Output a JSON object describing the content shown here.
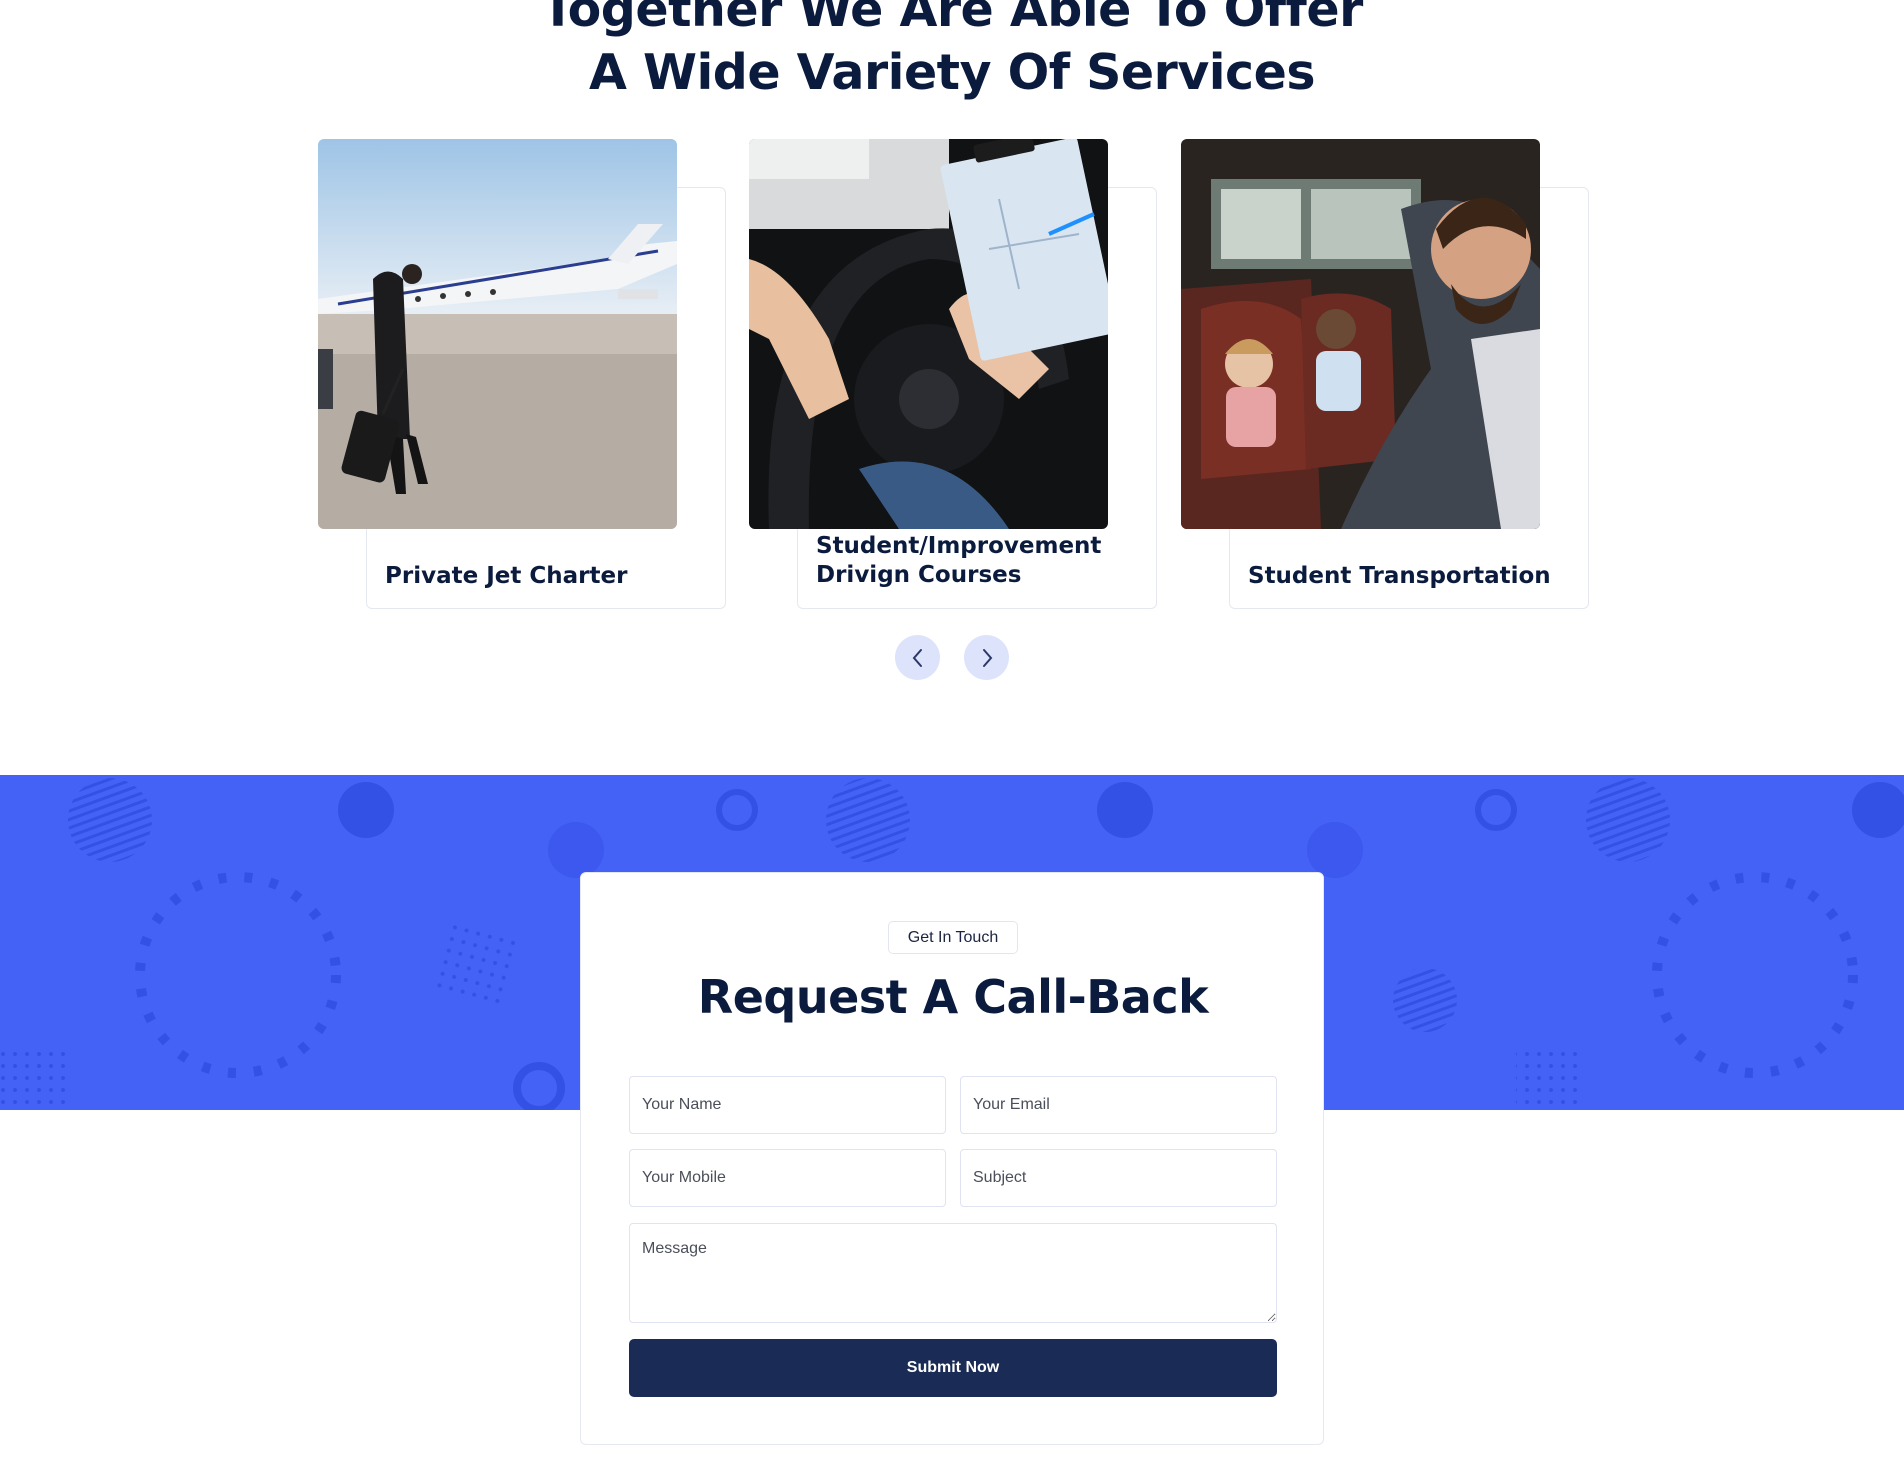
{
  "services_section": {
    "heading_line1": "Together We Are Able To Offer",
    "heading_line2": "A Wide Variety Of Services",
    "cards": [
      {
        "title": "Private Jet Charter"
      },
      {
        "title_line1": "Student/Improvement",
        "title_line2": "Drivign Courses"
      },
      {
        "title": "Student Transportation"
      }
    ],
    "prev_icon": "chevron-left-icon",
    "next_icon": "chevron-right-icon"
  },
  "callback_section": {
    "eyebrow": "Get In Touch",
    "title": "Request A Call-Back",
    "fields": {
      "name_placeholder": "Your Name",
      "email_placeholder": "Your Email",
      "mobile_placeholder": "Your Mobile",
      "subject_placeholder": "Subject",
      "message_placeholder": "Message"
    },
    "submit_label": "Submit Now"
  },
  "colors": {
    "heading": "#0b1b3d",
    "band": "#4462f5",
    "submit": "#1a2c55",
    "slider_btn": "#dde3fb"
  }
}
